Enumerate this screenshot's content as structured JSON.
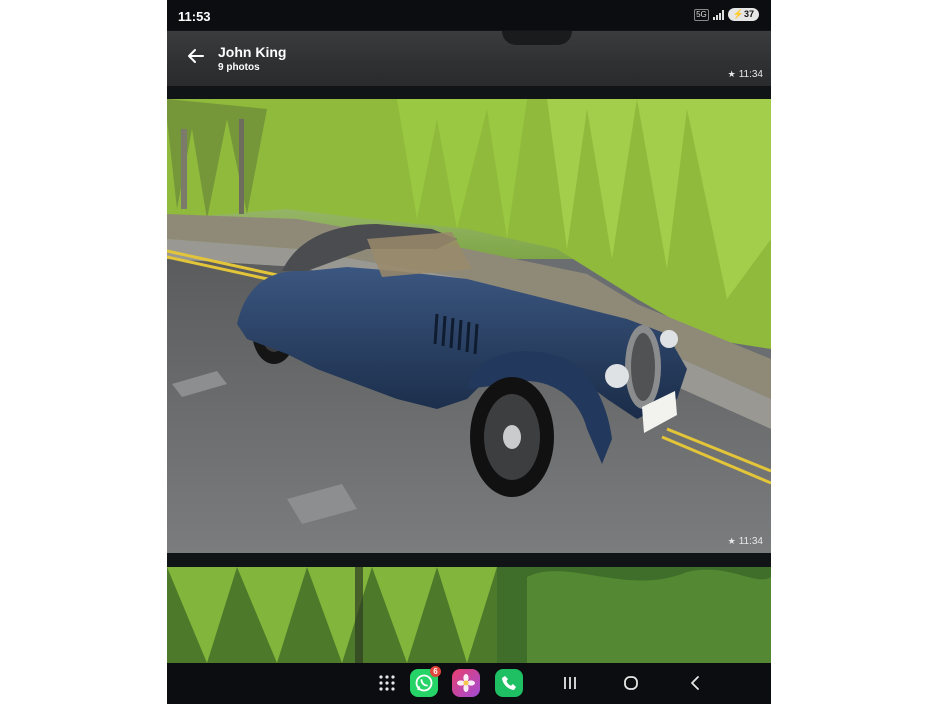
{
  "status_bar": {
    "time": "11:53",
    "network_badge": "5G",
    "battery": "37"
  },
  "header": {
    "title": "John King",
    "subtitle": "9 photos"
  },
  "photos": [
    {
      "timestamp": "11:34",
      "starred": true
    },
    {
      "timestamp": "11:34",
      "starred": true,
      "subject": "navy blue classic roadster parked on a street"
    },
    {
      "subject": "green willow trees"
    }
  ],
  "nav_bar": {
    "whatsapp_badge": "6",
    "icons": [
      "app-drawer-icon",
      "whatsapp-icon",
      "gallery-flower-icon",
      "phone-icon",
      "recents-icon",
      "home-icon",
      "back-icon"
    ]
  },
  "colors": {
    "whatsapp": "#25d366",
    "phone_app": "#1fbf63",
    "badge": "#e2453c",
    "car": "#1f3352"
  }
}
